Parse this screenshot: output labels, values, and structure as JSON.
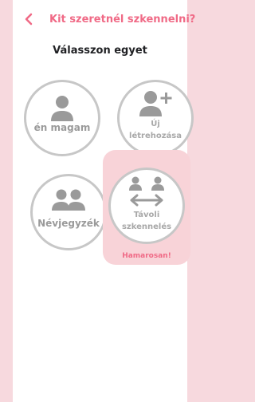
{
  "header": {
    "title": "Kit szeretnél szkennelni?"
  },
  "subtitle": "Válasszon egyet",
  "options": [
    {
      "label": "én magam"
    },
    {
      "label_line1": "Új",
      "label_line2": "létrehozása"
    },
    {
      "label": "Névjegyzék"
    },
    {
      "label_line1": "Távoli",
      "label_line2": "szkennelés",
      "badge": "Hamarosan!"
    }
  ],
  "colors": {
    "accent": "#f06a86",
    "muted": "#9a9a9a",
    "border": "#c7c7c7",
    "soon_bg": "#f8d3d8"
  },
  "icons": [
    "back-chevron-icon",
    "person-icon",
    "add-person-icon",
    "group-icon",
    "remote-scan-icon"
  ]
}
